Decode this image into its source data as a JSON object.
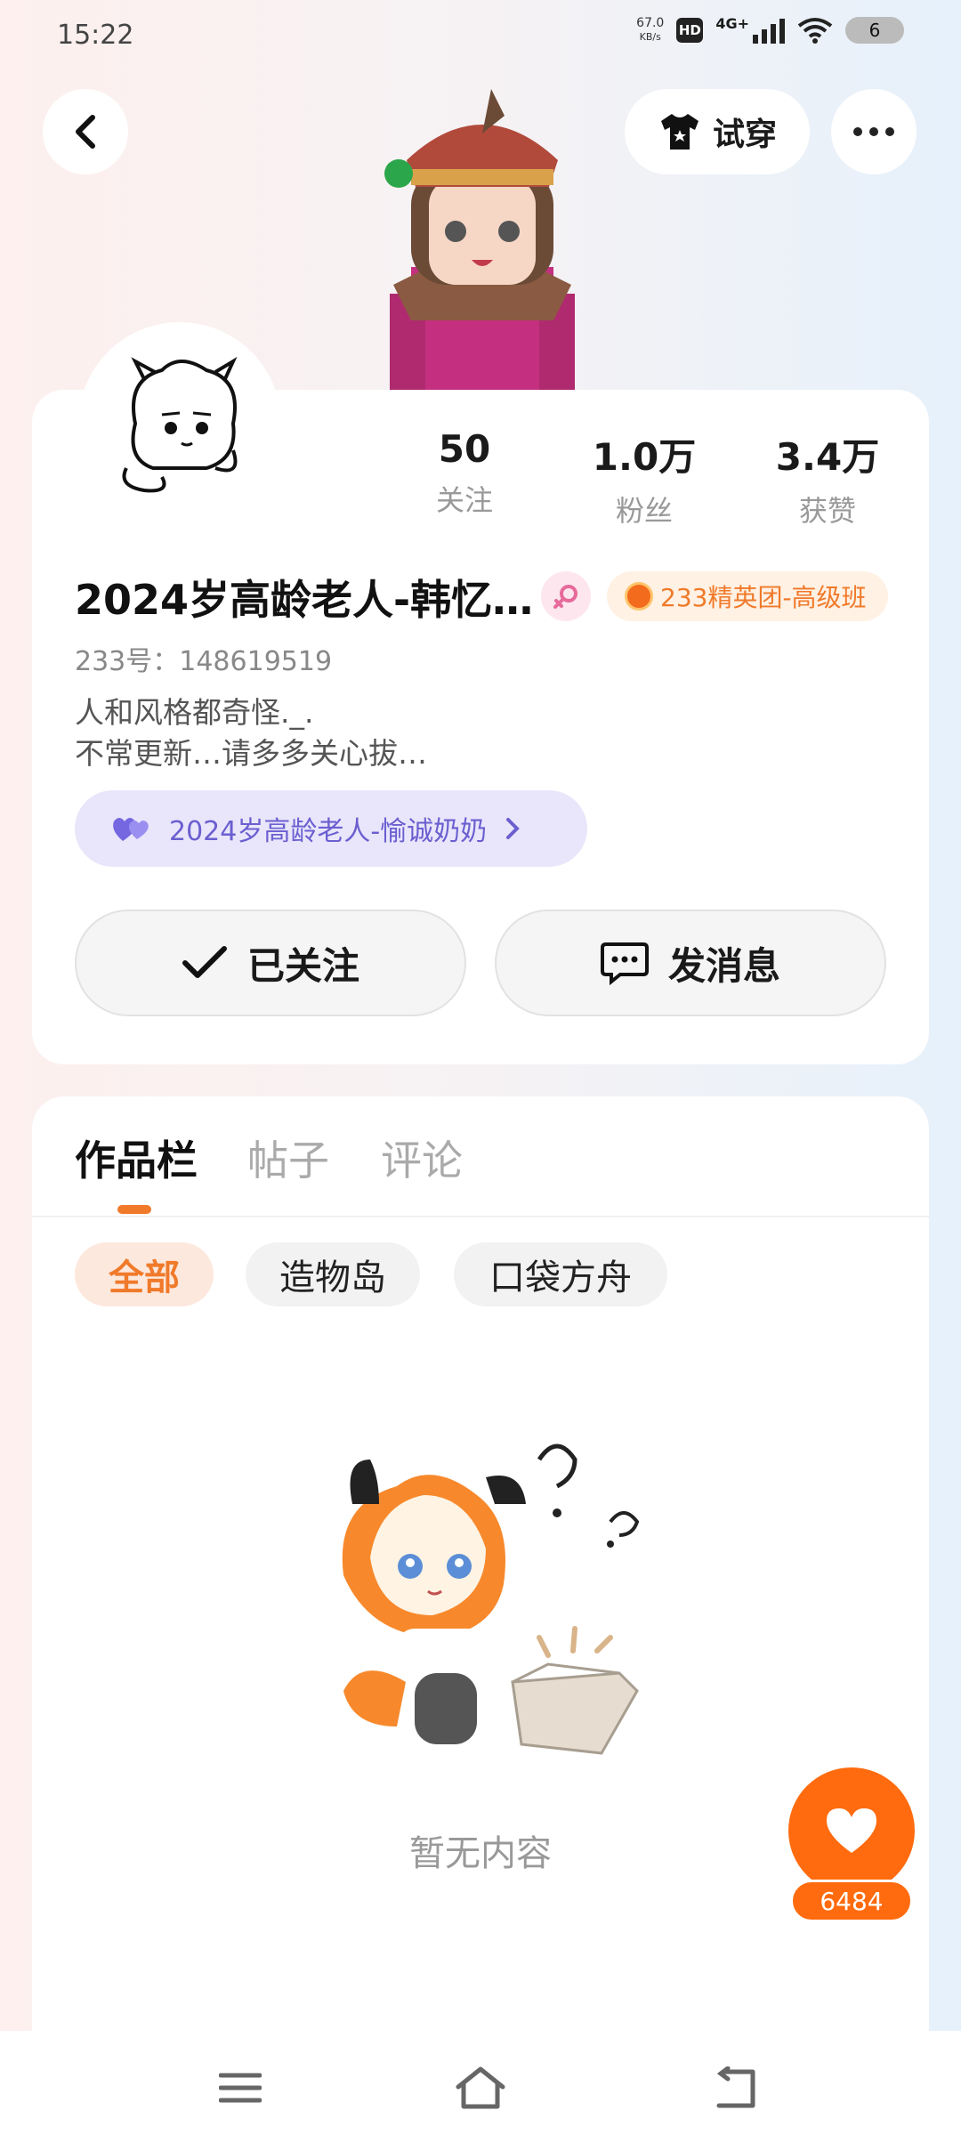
{
  "status_bar": {
    "time": "15:22",
    "net_speed_value": "67.0",
    "net_speed_unit": "KB/s",
    "hd": "HD",
    "network": "4G+",
    "battery": "6"
  },
  "top_bar": {
    "try_on_label": "试穿"
  },
  "profile": {
    "stats": [
      {
        "value": "50",
        "label": "关注"
      },
      {
        "value": "1.0万",
        "label": "粉丝"
      },
      {
        "value": "3.4万",
        "label": "获赞"
      }
    ],
    "username": "2024岁高龄老人-韩忆…",
    "badge_label": "233精英团-高级班",
    "account_id": "233号：148619519",
    "bio_line1": "人和风格都奇怪._.",
    "bio_line2": "不常更新…请多多关心拔…",
    "partner_label": "2024岁高龄老人-愉诚奶奶",
    "followed_label": "已关注",
    "message_label": "发消息"
  },
  "tabs": [
    "作品栏",
    "帖子",
    "评论"
  ],
  "filters": [
    "全部",
    "造物岛",
    "口袋方舟"
  ],
  "empty_text": "暂无内容",
  "fab": {
    "count": "6484"
  },
  "colors": {
    "accent": "#f07a2a",
    "fab": "#ff6b0e",
    "partner": "#6b5fd0"
  }
}
